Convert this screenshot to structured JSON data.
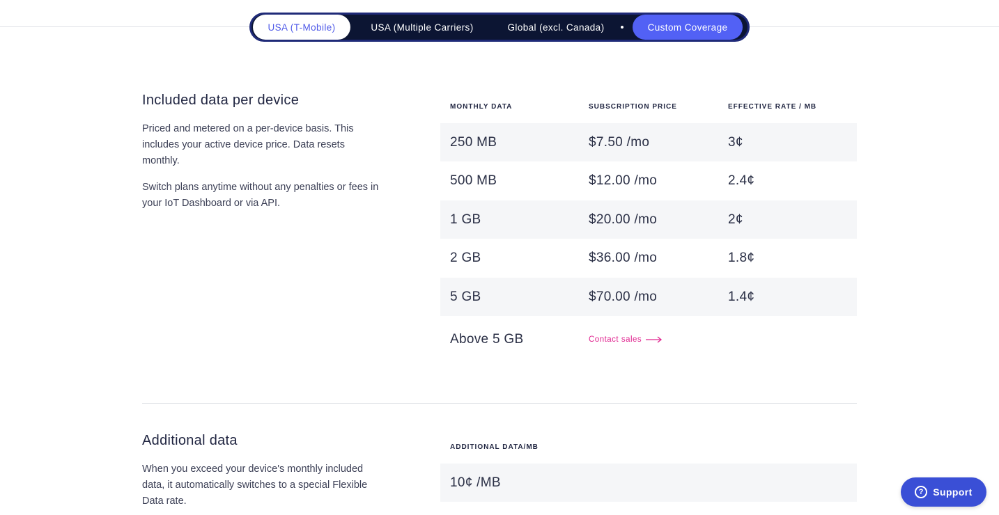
{
  "tabs": [
    {
      "label": "USA (T-Mobile)"
    },
    {
      "label": "USA (Multiple Carriers)"
    },
    {
      "label": "Global (excl. Canada)"
    },
    {
      "label": "Custom Coverage"
    }
  ],
  "included": {
    "title": "Included data per device",
    "paragraphs": [
      "Priced and metered on a per-device basis. This includes your active device price. Data resets monthly.",
      "Switch plans anytime without any penalties or fees in your IoT Dashboard or via API."
    ],
    "headers": [
      "MONTHLY DATA",
      "SUBSCRIPTION PRICE",
      "EFFECTIVE RATE / MB"
    ],
    "rows": [
      [
        "250 MB",
        "$7.50 /mo",
        "3¢"
      ],
      [
        "500 MB",
        "$12.00 /mo",
        "2.4¢"
      ],
      [
        "1 GB",
        "$20.00 /mo",
        "2¢"
      ],
      [
        "2 GB",
        "$36.00 /mo",
        "1.8¢"
      ],
      [
        "5 GB",
        "$70.00 /mo",
        "1.4¢"
      ]
    ],
    "above": {
      "label": "Above 5 GB",
      "link": "Contact sales"
    }
  },
  "additional": {
    "title": "Additional data",
    "paragraph": "When you exceed your device's monthly included data, it automatically switches to a special Flexible Data rate.",
    "header": "ADDITIONAL DATA/MB",
    "value": "10¢ /MB"
  },
  "support": {
    "label": "Support",
    "icon": "question-icon"
  }
}
